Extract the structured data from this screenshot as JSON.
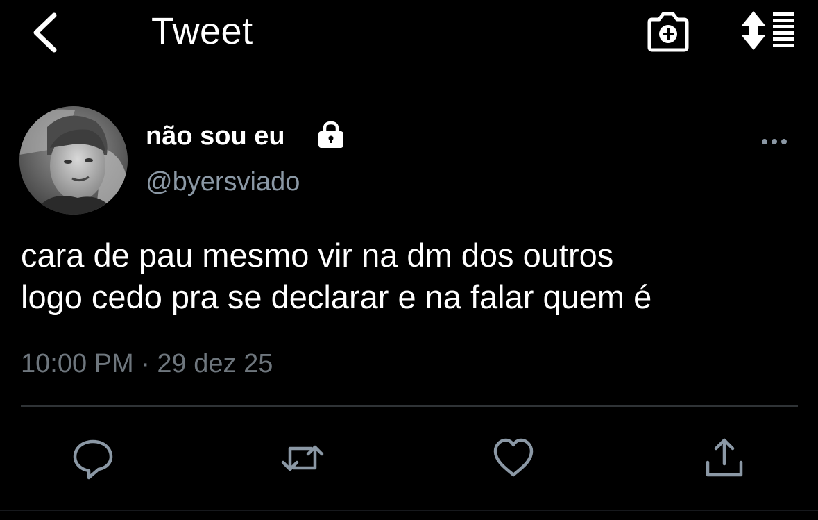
{
  "header": {
    "title": "Tweet",
    "back_icon": "chevron-left-icon",
    "camera_icon": "camera-plus-icon",
    "sort_icon": "sort-list-icon"
  },
  "tweet": {
    "display_name": "não sou eu",
    "protected_icon": "lock-icon",
    "handle": "@byersviado",
    "text": "cara de pau mesmo vir na dm dos outros\nlogo cedo pra se declarar e na falar quem é",
    "timestamp": "10:00 PM · 29 dez 25",
    "more_icon": "more-horizontal-icon"
  },
  "actions": {
    "reply_icon": "reply-icon",
    "retweet_icon": "retweet-icon",
    "like_icon": "heart-icon",
    "share_icon": "share-icon"
  },
  "colors": {
    "background": "#000000",
    "text_primary": "#ffffff",
    "text_secondary": "#8b98a5",
    "timestamp": "#6e767d",
    "icon_muted": "#8b98a5",
    "divider": "#2f3336"
  }
}
